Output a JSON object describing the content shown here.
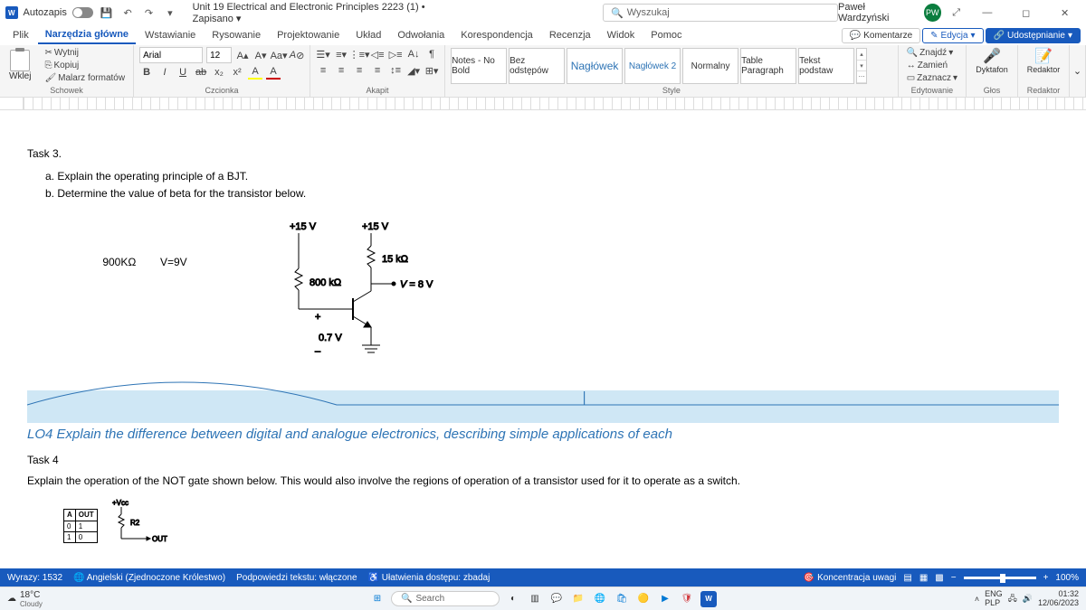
{
  "titlebar": {
    "autosave_label": "Autozapis",
    "doc_title": "Unit 19 Electrical and Electronic Principles 2223 (1) • Zapisano ▾",
    "search_placeholder": "Wyszukaj",
    "user_name": "Paweł Wardzyński",
    "user_initials": "PW"
  },
  "tabs": {
    "file": "Plik",
    "home": "Narzędzia główne",
    "insert": "Wstawianie",
    "draw": "Rysowanie",
    "design": "Projektowanie",
    "layout": "Układ",
    "references": "Odwołania",
    "mailings": "Korespondencja",
    "review": "Recenzja",
    "view": "Widok",
    "help": "Pomoc",
    "comments": "Komentarze",
    "editing": "Edycja",
    "share": "Udostępnianie"
  },
  "ribbon": {
    "paste": "Wklej",
    "cut": "Wytnij",
    "copy": "Kopiuj",
    "format_painter": "Malarz formatów",
    "clipboard_label": "Schowek",
    "font_name": "Arial",
    "font_size": "12",
    "font_label": "Czcionka",
    "paragraph_label": "Akapit",
    "styles": {
      "s1_sample": "Notes - No Bold",
      "s2_sample": "Bez odstępów",
      "s3_sample": "Nagłówek",
      "s4_sample": "Nagłówek 2",
      "s5_sample": "Normalny",
      "s6_sample": "Table Paragraph",
      "s7_sample": "Tekst podstaw"
    },
    "styles_label": "Style",
    "find": "Znajdź",
    "replace": "Zamień",
    "select": "Zaznacz",
    "editing_label": "Edytowanie",
    "dictate": "Dyktafon",
    "voice_label": "Głos",
    "editor": "Redaktor",
    "editor_label": "Redaktor"
  },
  "doc": {
    "task3": "Task 3.",
    "task3a": "a. Explain the operating principle of a BJT.",
    "task3b": "b. Determine the value of beta for the transistor below.",
    "val_900k": "900ΚΩ",
    "val_v9": "V=9V",
    "v15_1": "+15 V",
    "v15_2": "+15 V",
    "r15k": "15 kΩ",
    "r800k": "800 kΩ",
    "veq": "V = 8 V",
    "plus": "+",
    "v07": "0.7 V",
    "minus": "–",
    "lo4": "LO4 Explain the difference between digital and analogue electronics, describing simple applications of each",
    "task4": "Task 4",
    "task4_body": "Explain the operation of the NOT gate shown below. This would also involve the regions of operation of a transistor used for it to operate as a switch.",
    "vcc": "+Vcc",
    "r2": "R2",
    "out": "OUT",
    "tt_a": "A",
    "tt_out": "OUT",
    "tt_0": "0",
    "tt_1": "1"
  },
  "statusbar": {
    "words": "Wyrazy: 1532",
    "lang": "Angielski (Zjednoczone Królestwo)",
    "predictions": "Podpowiedzi tekstu: włączone",
    "accessibility": "Ułatwienia dostępu: zbadaj",
    "focus": "Koncentracja uwagi",
    "zoom": "100%"
  },
  "taskbar": {
    "temp": "18°C",
    "weather": "Cloudy",
    "search": "Search",
    "lang1": "ENG",
    "lang2": "PLP",
    "time": "01:32",
    "date": "12/06/2023"
  }
}
